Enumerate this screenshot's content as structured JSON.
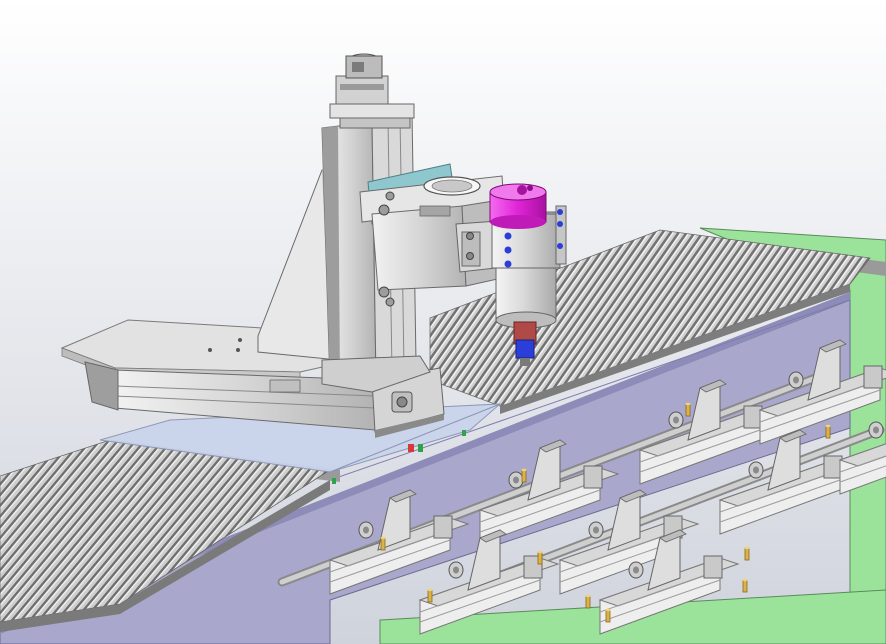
{
  "viewport": {
    "background_top": "#ffffff",
    "background_bottom": "#cfd3dc"
  },
  "colors": {
    "frame_green": "#9be39b",
    "rail_purple": "#a9a7cc",
    "metal_light": "#e2e2e2",
    "metal_mid": "#c4c4c4",
    "metal_dark": "#8f8f8f",
    "spindle_magenta": "#e024d8",
    "fastener_blue": "#2b3fd8",
    "tool_red": "#b04a46",
    "glass_blue": "#c9d4ec",
    "pin_brass": "#d9b24a",
    "rod_grey": "#b5b5b5"
  },
  "parts": {
    "spindle_motor": "spindle-motor",
    "z_axis_carriage": "z-axis-carriage",
    "gantry_upright": "gantry-upright",
    "vacuum_table": "slatted-table",
    "pod_rails": "pod-rails",
    "vacuum_pods": "vacuum-pods"
  }
}
